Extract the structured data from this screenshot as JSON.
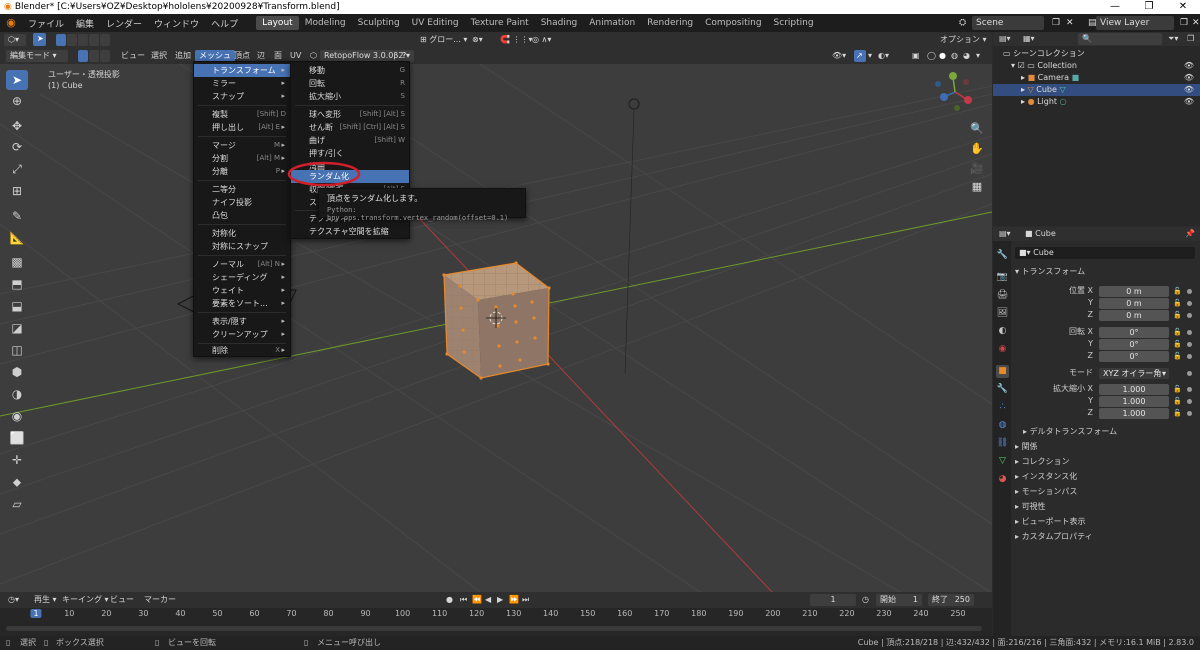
{
  "window": {
    "title": "Blender* [C:¥Users¥OZ¥Desktop¥hololens¥20200928¥Transform.blend]",
    "minimize": "—",
    "maximize": "❐",
    "close": "✕"
  },
  "topmenu": {
    "items": [
      "ファイル",
      "編集",
      "レンダー",
      "ウィンドウ",
      "ヘルプ"
    ]
  },
  "workspaces": [
    "Layout",
    "Modeling",
    "Sculpting",
    "UV Editing",
    "Texture Paint",
    "Shading",
    "Animation",
    "Rendering",
    "Compositing",
    "Scripting"
  ],
  "scene": {
    "label": "Scene",
    "viewlayer": "View Layer"
  },
  "viewport_header": {
    "mode": "編集モード",
    "menus": [
      "ビュー",
      "選択",
      "追加",
      "メッシュ",
      "頂点",
      "辺",
      "面",
      "UV"
    ],
    "addon": "RetopoFlow 3.0.0β2",
    "orientation": "グロー...",
    "options": "オプション"
  },
  "viewport": {
    "view_name": "ユーザー・透視投影",
    "object_name": "(1) Cube"
  },
  "mesh_menu": {
    "items": [
      {
        "label": "トランスフォーム",
        "shortcut": "",
        "submenu": true,
        "highlight": true
      },
      {
        "label": "ミラー",
        "shortcut": "",
        "submenu": true
      },
      {
        "label": "スナップ",
        "shortcut": "",
        "submenu": true
      },
      {
        "label": "複製",
        "shortcut": "[Shift] D"
      },
      {
        "label": "押し出し",
        "shortcut": "[Alt] E",
        "submenu": true
      },
      {
        "label": "マージ",
        "shortcut": "M",
        "submenu": true
      },
      {
        "label": "分割",
        "shortcut": "[Alt] M",
        "submenu": true
      },
      {
        "label": "分離",
        "shortcut": "P",
        "submenu": true
      },
      {
        "label": "二等分",
        "shortcut": ""
      },
      {
        "label": "ナイフ投影",
        "shortcut": ""
      },
      {
        "label": "凸包",
        "shortcut": ""
      },
      {
        "label": "対称化",
        "shortcut": ""
      },
      {
        "label": "対称にスナップ",
        "shortcut": ""
      },
      {
        "label": "ノーマル",
        "shortcut": "[Alt] N",
        "submenu": true
      },
      {
        "label": "シェーディング",
        "shortcut": "",
        "submenu": true
      },
      {
        "label": "ウェイト",
        "shortcut": "",
        "submenu": true
      },
      {
        "label": "要素をソート...",
        "shortcut": "",
        "submenu": true
      },
      {
        "label": "表示/隠す",
        "shortcut": "",
        "submenu": true
      },
      {
        "label": "クリーンアップ",
        "shortcut": "",
        "submenu": true
      },
      {
        "label": "削除",
        "shortcut": "X",
        "submenu": true
      }
    ]
  },
  "transform_menu": {
    "items": [
      {
        "label": "移動",
        "shortcut": "G"
      },
      {
        "label": "回転",
        "shortcut": "R"
      },
      {
        "label": "拡大縮小",
        "shortcut": "S"
      },
      {
        "label": "球へ変形",
        "shortcut": "[Shift] [Alt] S"
      },
      {
        "label": "せん断",
        "shortcut": "[Shift] [Ctrl] [Alt] S"
      },
      {
        "label": "曲げ",
        "shortcut": "[Shift] W"
      },
      {
        "label": "押す/引く",
        "shortcut": ""
      },
      {
        "label": "湾曲",
        "shortcut": ""
      },
      {
        "label": "ランダム化",
        "shortcut": "",
        "highlight": true
      },
      {
        "label": "収縮/膨張",
        "shortcut": "[Alt] S"
      },
      {
        "label": "スキン",
        "shortcut": ""
      },
      {
        "label": "テクスチャ",
        "shortcut": ""
      },
      {
        "label": "テクスチャ空間を拡縮",
        "shortcut": ""
      }
    ]
  },
  "tooltip": {
    "text": "頂点をランダム化します。",
    "python": "Python: bpy.ops.transform.vertex_random(offset=0.1)"
  },
  "timeline": {
    "menus": [
      "再生",
      "キーイング",
      "ビュー",
      "マーカー"
    ],
    "current_frame": "1",
    "start_label": "開始",
    "start": "1",
    "end_label": "終了",
    "end": "250",
    "ticks": [
      "1",
      "10",
      "20",
      "30",
      "40",
      "50",
      "60",
      "70",
      "80",
      "90",
      "100",
      "110",
      "120",
      "130",
      "140",
      "150",
      "160",
      "170",
      "180",
      "190",
      "200",
      "210",
      "220",
      "230",
      "240",
      "250"
    ]
  },
  "statusbar": {
    "select": "選択",
    "box_select": "ボックス選択",
    "rotate_view": "ビューを回転",
    "menu_call": "メニュー呼び出し",
    "stats": "Cube | 頂点:218/218 | 辺:432/432 | 面:216/216 | 三角面:432 | メモリ:16.1 MiB | 2.83.0"
  },
  "outliner": {
    "root": "シーンコレクション",
    "collection": "Collection",
    "items": [
      {
        "name": "Camera",
        "selected": false
      },
      {
        "name": "Cube",
        "selected": true
      },
      {
        "name": "Light",
        "selected": false
      }
    ]
  },
  "properties": {
    "header_object": "Cube",
    "object_name": "Cube",
    "transform_label": "トランスフォーム",
    "location_label": "位置 X",
    "rotation_label": "回転 X",
    "mode_label": "モード",
    "mode_value": "XYZ オイラー角",
    "scale_label": "拡大縮小 X",
    "axis_y": "Y",
    "axis_z": "Z",
    "location": [
      "0 m",
      "0 m",
      "0 m"
    ],
    "rotation": [
      "0°",
      "0°",
      "0°"
    ],
    "scale": [
      "1.000",
      "1.000",
      "1.000"
    ],
    "delta_label": "デルタトランスフォーム",
    "sections": [
      "関係",
      "コレクション",
      "インスタンス化",
      "モーションパス",
      "可視性",
      "ビューポート表示",
      "カスタムプロパティ"
    ]
  },
  "colors": {
    "accent": "#4772b3",
    "selection_orange": "#e5892c",
    "annotation_red": "#d21f2a",
    "x_axis": "#b33a3a",
    "y_axis": "#6e9a2a"
  }
}
